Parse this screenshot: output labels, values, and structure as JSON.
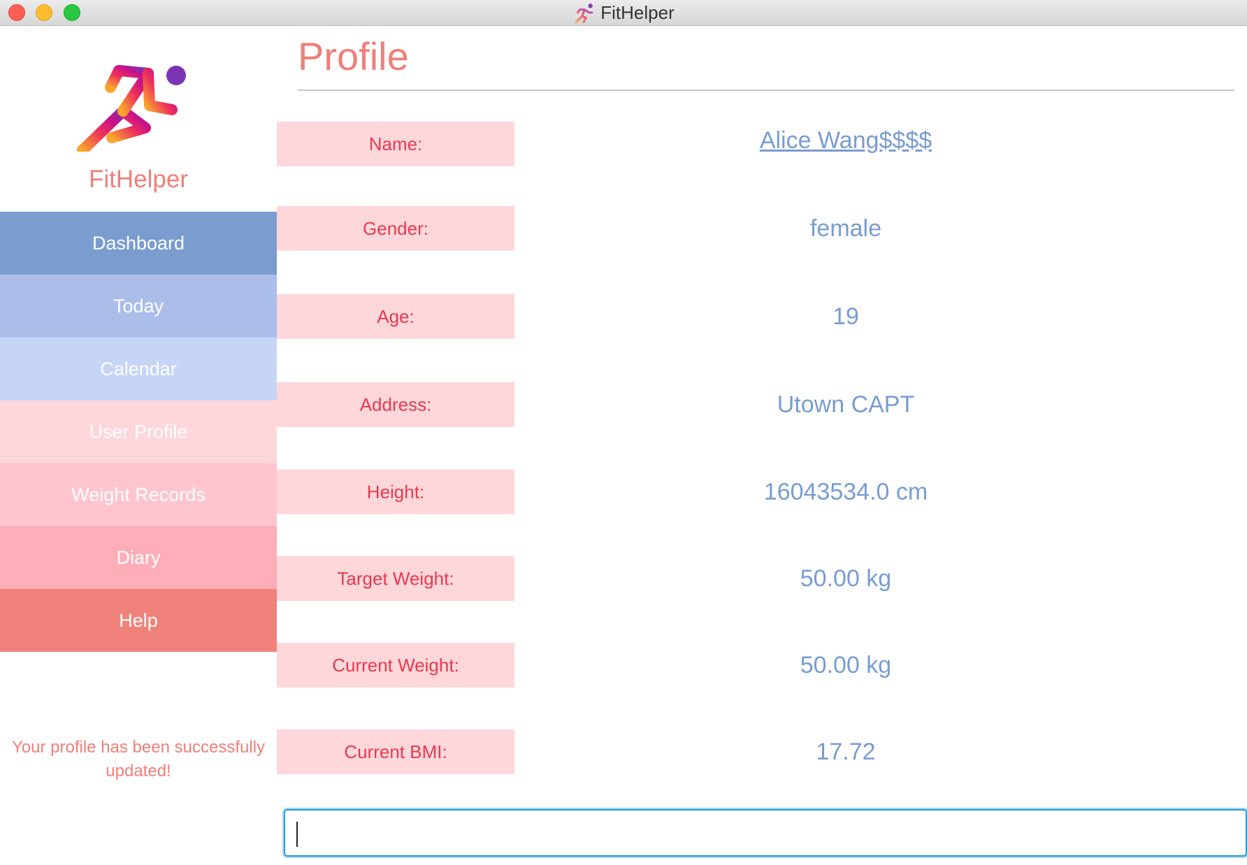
{
  "window": {
    "title": "FitHelper"
  },
  "sidebar": {
    "brand": "FitHelper",
    "logo_icon": "running-person-icon",
    "items": [
      {
        "label": "Dashboard",
        "color": "#7a9ccf"
      },
      {
        "label": "Today",
        "color": "#abbeea"
      },
      {
        "label": "Calendar",
        "color": "#c6d4f6"
      },
      {
        "label": "User Profile",
        "color": "#fed7db"
      },
      {
        "label": "Weight Records",
        "color": "#fec5cf"
      },
      {
        "label": "Diary",
        "color": "#feadb9"
      },
      {
        "label": "Help",
        "color": "#f0827b"
      }
    ],
    "status_message": "Your profile has been successfully updated!"
  },
  "main": {
    "title": "Profile",
    "fields": [
      {
        "label": "Name:",
        "value": "Alice Wang$$$$"
      },
      {
        "label": "Gender:",
        "value": "female"
      },
      {
        "label": "Age:",
        "value": "19"
      },
      {
        "label": "Address:",
        "value": "Utown CAPT"
      },
      {
        "label": "Height:",
        "value": "16043534.0 cm"
      },
      {
        "label": "Target Weight:",
        "value": "50.00 kg"
      },
      {
        "label": "Current Weight:",
        "value": "50.00 kg"
      },
      {
        "label": "Current BMI:",
        "value": "17.72"
      }
    ]
  },
  "command_box": {
    "value": ""
  },
  "colors": {
    "accent_pink": "#ef7f79",
    "label_red": "#e8394e",
    "value_blue": "#7a9ccf",
    "label_bg": "#fed7db"
  }
}
